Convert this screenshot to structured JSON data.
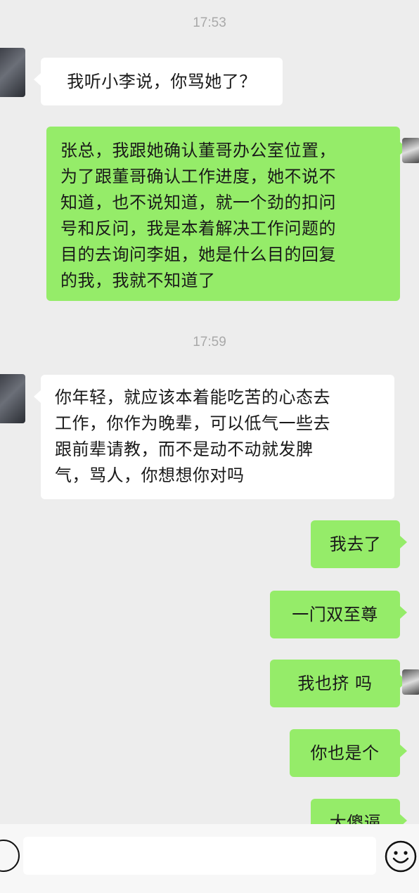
{
  "timestamps": [
    "17:53",
    "17:59"
  ],
  "messages": [
    {
      "side": "in",
      "text": "我听小李说，你骂她了？"
    },
    {
      "side": "out",
      "lines": [
        "张总，我跟她确认董哥办公室位置，",
        "为了跟董哥确认工作进度，她不说不",
        "知道，也不说知道，就一个劲的扣问",
        "号和反问，我是本着解决工作问题的",
        "目的去询问李姐，她是什么目的回复",
        "的我，我就不知道了"
      ]
    },
    {
      "side": "in",
      "lines": [
        "你年轻，就应该本着能吃苦的心态去",
        "工作，你作为晚辈，可以低气一些去",
        "跟前辈请教，而不是动不动就发脾",
        "气，骂人，你想想你对吗"
      ]
    },
    {
      "side": "out",
      "text": "我去了"
    },
    {
      "side": "out",
      "text": "一门双至尊"
    },
    {
      "side": "out",
      "text": "我也挤 吗"
    },
    {
      "side": "out",
      "text": "你也是个"
    },
    {
      "side": "out",
      "text": "大傻逼"
    }
  ],
  "colors": {
    "background": "#ededed",
    "incoming_bubble": "#ffffff",
    "outgoing_bubble": "#95ec69",
    "timestamp": "#a9a9a9"
  },
  "icons": {
    "voice": "voice-icon",
    "emoji": "emoji-icon"
  }
}
